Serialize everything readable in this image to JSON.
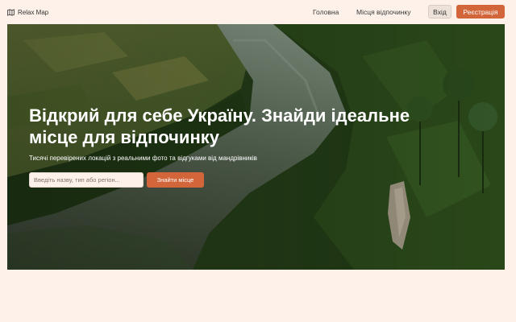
{
  "brand": {
    "name": "Relax Map",
    "icon": "map-icon"
  },
  "nav": {
    "links": [
      {
        "label": "Головна"
      },
      {
        "label": "Місця відпочинку"
      }
    ],
    "login_label": "Вхід",
    "register_label": "Реєстрація"
  },
  "hero": {
    "title": "Відкрий для себе Україну. Знайди ідеальне місце для відпочинку",
    "subtitle": "Тисячі перевірених локацій з реальними фото та відгуками від мандрівників",
    "search_placeholder": "Введіть назву, тип або регіон...",
    "search_button_label": "Знайти місце",
    "image": "river-valley-photo"
  },
  "colors": {
    "background": "#fdf1ea",
    "accent": "#d2653a",
    "login_button": "#ede2da"
  }
}
